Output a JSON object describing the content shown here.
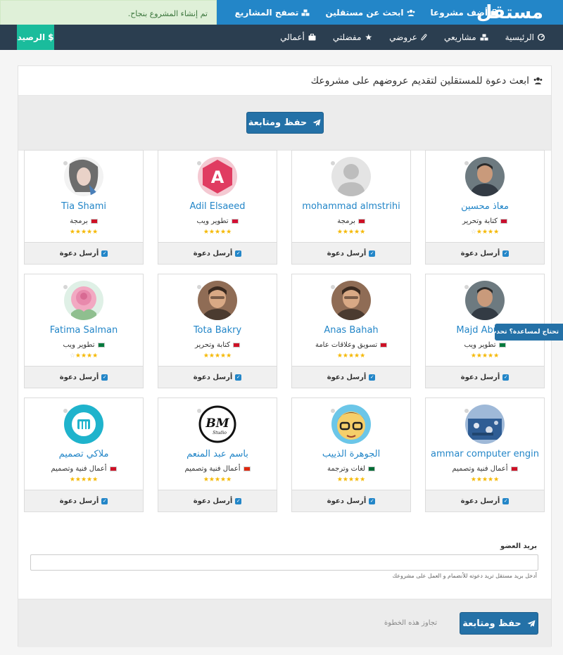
{
  "header": {
    "brand": "مستقل",
    "nav": [
      {
        "label": "أضف مشروعا",
        "icon": "briefcase-icon"
      },
      {
        "label": "ابحث عن مستقلين",
        "icon": "users-icon"
      },
      {
        "label": "تصفح المشاريع",
        "icon": "cubes-icon"
      }
    ],
    "toast": "تم إنشاء المشروع بنجاح."
  },
  "subnav": {
    "items": [
      {
        "label": "الرئيسية",
        "icon": "dashboard-icon"
      },
      {
        "label": "مشاريعي",
        "icon": "cubes-icon"
      },
      {
        "label": "عروضي",
        "icon": "paperclip-icon"
      },
      {
        "label": "مفضلتي",
        "icon": "star-icon"
      },
      {
        "label": "أعمالي",
        "icon": "briefcase-icon"
      }
    ],
    "balance": "الرصيد",
    "balance_symbol": "$"
  },
  "panel": {
    "heading": "ابعث دعوة للمستقلين لتقديم عروضهم على مشروعك",
    "save_label": "حفظ ومتابعة",
    "invite_label": "أرسل دعوة"
  },
  "freelancers": [
    {
      "name": "معاذ محسين",
      "skill": "كتابة وتحرير",
      "rating": 4,
      "flag": "#c8102e",
      "avatar": "photo-dark"
    },
    {
      "name": "mohammad almstrihi",
      "skill": "برمجة",
      "rating": 5,
      "flag": "#ce1126",
      "avatar": "default"
    },
    {
      "name": "Adil Elsaeed",
      "skill": "تطوير ويب",
      "rating": 5,
      "flag": "#d21034",
      "avatar": "letter-a"
    },
    {
      "name": "Tia Shami",
      "skill": "برمجة",
      "rating": 5,
      "flag": "#ce1126",
      "avatar": "photo-light"
    },
    {
      "name": "Majd Abu Sh",
      "skill": "تطوير ويب",
      "rating": 5,
      "flag": "#007a3d",
      "avatar": "photo-dark"
    },
    {
      "name": "Anas Bahah",
      "skill": "تسويق وعلاقات عامة",
      "rating": 5,
      "flag": "#ce1126",
      "avatar": "photo-warm"
    },
    {
      "name": "Tota Bakry",
      "skill": "كتابة وتحرير",
      "rating": 5,
      "flag": "#ce1126",
      "avatar": "photo-warm"
    },
    {
      "name": "Fatima Salman",
      "skill": "تطوير ويب",
      "rating": 4,
      "flag": "#007a3d",
      "avatar": "rose"
    },
    {
      "name": "ammar computer engin",
      "skill": "أعمال فنية وتصميم",
      "rating": 5,
      "flag": "#ce1126",
      "avatar": "photo-blue"
    },
    {
      "name": "الجوهرة الذييب",
      "skill": "لغات وترجمة",
      "rating": 5,
      "flag": "#006c35",
      "avatar": "cartoon"
    },
    {
      "name": "باسم عبد المنعم",
      "skill": "أعمال فنية وتصميم",
      "rating": 5,
      "flag": "#de2910",
      "avatar": "logo-bm"
    },
    {
      "name": "ملاكي تصميم",
      "skill": "أعمال فنية وتصميم",
      "rating": 5,
      "flag": "#ce1126",
      "avatar": "logo-m"
    }
  ],
  "email": {
    "label": "بريد العضو",
    "value": "",
    "help": "أدخل بريد مستقل تريد دعوته للأنضمام و العمل على مشروعك"
  },
  "footer": {
    "save_label": "حفظ ومتابعة",
    "skip_label": "تجاوز هذه الخطوة"
  },
  "help_tab": "تحتاج لمساعدة؟ تحدث معنا",
  "colors": {
    "topbar": "#2386c8",
    "subbar": "#2b3e50",
    "balance": "#1abc9c",
    "primary": "#2471a7",
    "star": "#f5b800"
  }
}
